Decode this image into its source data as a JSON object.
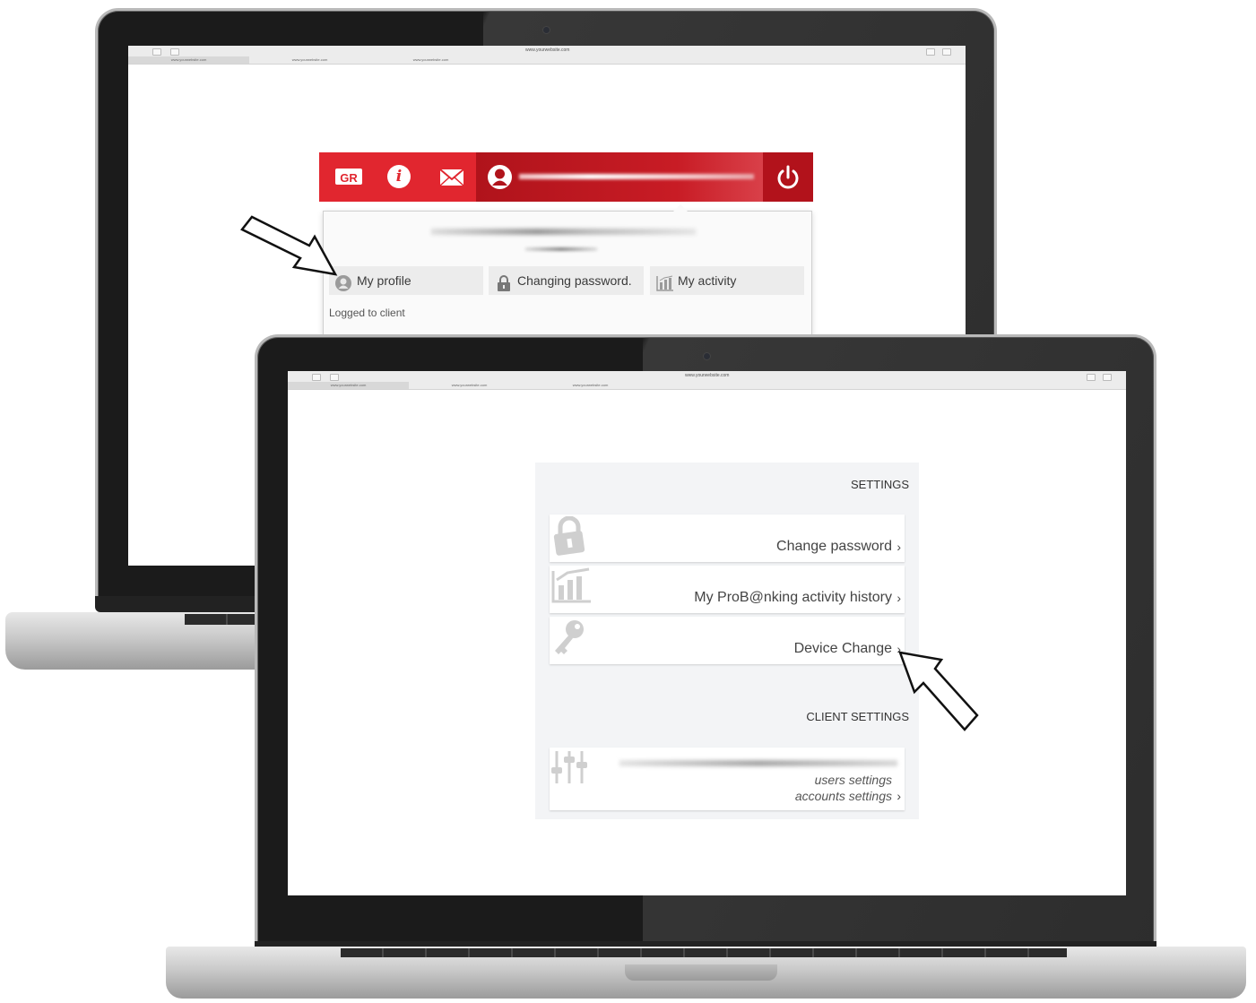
{
  "browser": {
    "url": "www.yourwebsite.com",
    "tabs": [
      "www.yourwebsite.com",
      "www.yourwebsite.com",
      "www.yourwebsite.com"
    ]
  },
  "top_bar": {
    "language_label": "GR",
    "info_label": "i",
    "icons": [
      "language-icon",
      "info-icon",
      "mail-icon",
      "user-icon",
      "power-icon"
    ],
    "accent_color": "#e1262f",
    "dark_accent_color": "#b2121b"
  },
  "profile_menu": {
    "tabs": [
      {
        "label": "My profile",
        "icon": "user-icon"
      },
      {
        "label": "Changing password.",
        "icon": "lock-icon"
      },
      {
        "label": "My activity",
        "icon": "activity-chart-icon"
      }
    ],
    "logged_label": "Logged to client"
  },
  "settings": {
    "heading": "SETTINGS",
    "items": [
      {
        "label": "Change password",
        "icon": "lock-icon"
      },
      {
        "label": "My ProB@nking activity history",
        "icon": "activity-chart-icon"
      },
      {
        "label": "Device Change",
        "icon": "key-icon"
      }
    ],
    "client_heading": "CLIENT SETTINGS",
    "client_card": {
      "icon": "sliders-icon",
      "line1": "users settings",
      "line2": "accounts settings"
    },
    "chevron": "›"
  }
}
